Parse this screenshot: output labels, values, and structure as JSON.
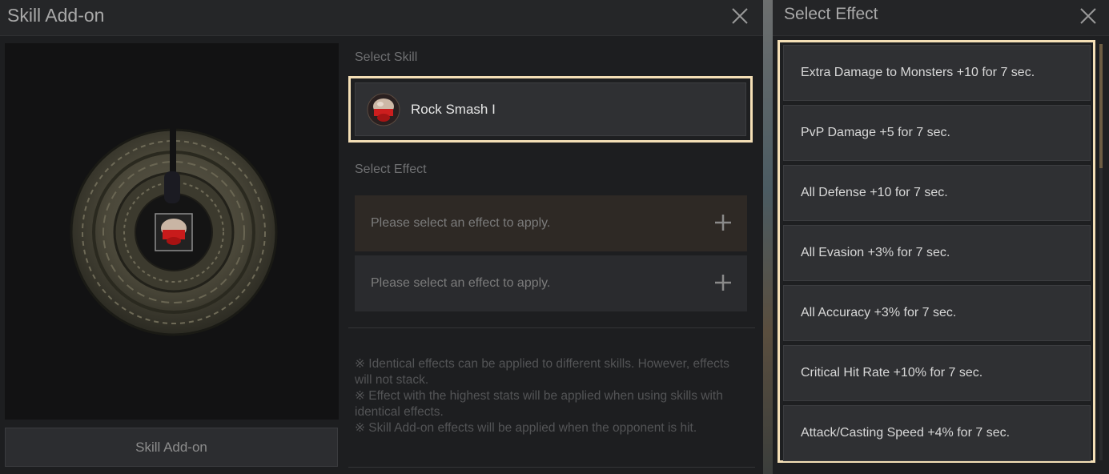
{
  "left_window": {
    "title": "Skill Add-on",
    "select_skill_label": "Select Skill",
    "selected_skill": {
      "name": "Rock Smash I",
      "icon": "rock-smash-skill-icon"
    },
    "select_effect_label": "Select Effect",
    "effect_slots": [
      {
        "placeholder": "Please select an effect to apply.",
        "state": "selected"
      },
      {
        "placeholder": "Please select an effect to apply.",
        "state": "empty"
      }
    ],
    "notes": [
      "※ Identical effects can be applied to different skills. However, effects will not stack.",
      "※ Effect with the highest stats will be applied when using skills with identical effects.",
      "※ Skill Add-on effects will be applied when the opponent is hit."
    ],
    "action_button": "Skill Add-on"
  },
  "right_window": {
    "title": "Select Effect",
    "effects": [
      "Extra Damage to Monsters +10 for 7 sec.",
      "PvP Damage +5 for 7 sec.",
      "All Defense +10 for 7 sec.",
      "All Evasion +3% for 7 sec.",
      "All Accuracy +3% for 7 sec.",
      "Critical Hit Rate +10% for 7 sec.",
      "Attack/Casting Speed +4% for 7 sec."
    ]
  },
  "colors": {
    "highlight_border": "#f4dfb6",
    "panel_bg": "#1d1e20",
    "item_bg": "#2f3033",
    "selected_slot_bg": "#2e2925"
  }
}
